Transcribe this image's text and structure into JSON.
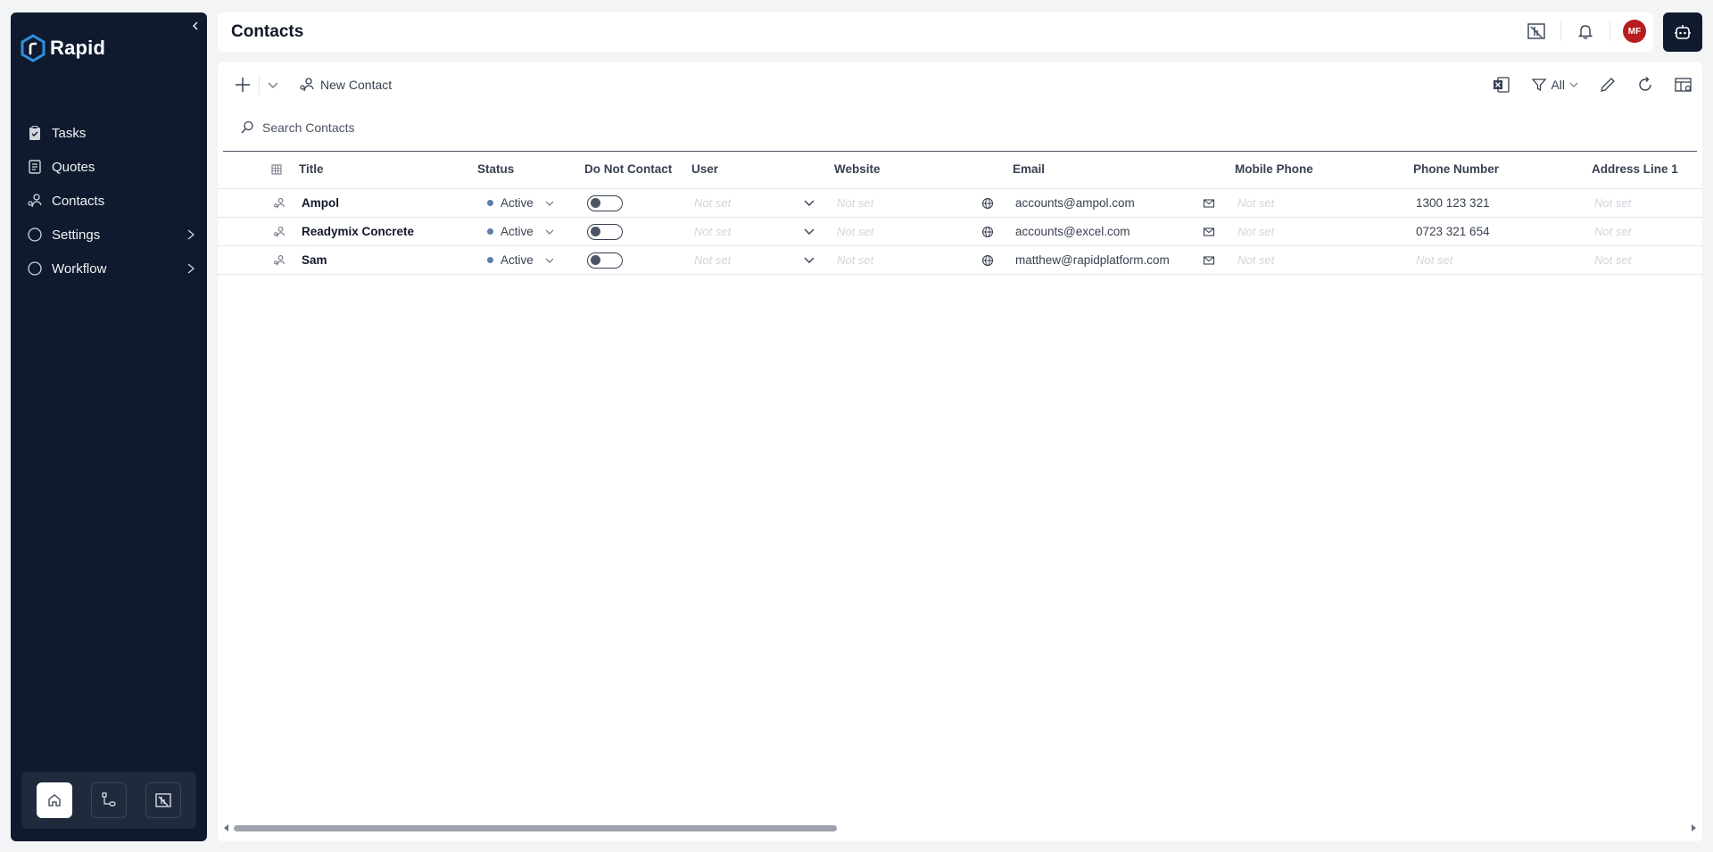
{
  "app": {
    "name": "Rapid"
  },
  "sidebar": {
    "items": [
      {
        "label": "Tasks",
        "icon": "clipboard-icon"
      },
      {
        "label": "Quotes",
        "icon": "document-icon"
      },
      {
        "label": "Contacts",
        "icon": "contacts-icon"
      },
      {
        "label": "Settings",
        "icon": "circle-icon",
        "expandable": true
      },
      {
        "label": "Workflow",
        "icon": "circle-icon",
        "expandable": true
      }
    ],
    "bottom": [
      "home-icon",
      "flow-icon",
      "dashboard-icon"
    ]
  },
  "header": {
    "title": "Contacts",
    "avatar_initials": "MF"
  },
  "toolbar": {
    "new_contact_label": "New Contact",
    "filter_label": "All"
  },
  "search": {
    "placeholder": "Search Contacts"
  },
  "table": {
    "columns": [
      "Title",
      "Status",
      "Do Not Contact",
      "User",
      "Website",
      "Email",
      "Mobile Phone",
      "Phone Number",
      "Address Line 1"
    ],
    "rows": [
      {
        "title": "Ampol",
        "status": "Active",
        "do_not_contact": false,
        "user": "Not set",
        "website": "Not set",
        "email": "accounts@ampol.com",
        "mobile": "Not set",
        "phone": "1300 123 321",
        "address": "Not set"
      },
      {
        "title": "Readymix Concrete",
        "status": "Active",
        "do_not_contact": false,
        "user": "Not set",
        "website": "Not set",
        "email": "accounts@excel.com",
        "mobile": "Not set",
        "phone": "0723 321 654",
        "address": "Not set"
      },
      {
        "title": "Sam",
        "status": "Active",
        "do_not_contact": false,
        "user": "Not set",
        "website": "Not set",
        "email": "matthew@rapidplatform.com",
        "mobile": "Not set",
        "phone": "Not set",
        "address": "Not set"
      }
    ]
  },
  "colors": {
    "sidebar_bg": "#0f1a2e",
    "avatar_bg": "#b91c1c",
    "status_dot": "#5b7fa6"
  }
}
